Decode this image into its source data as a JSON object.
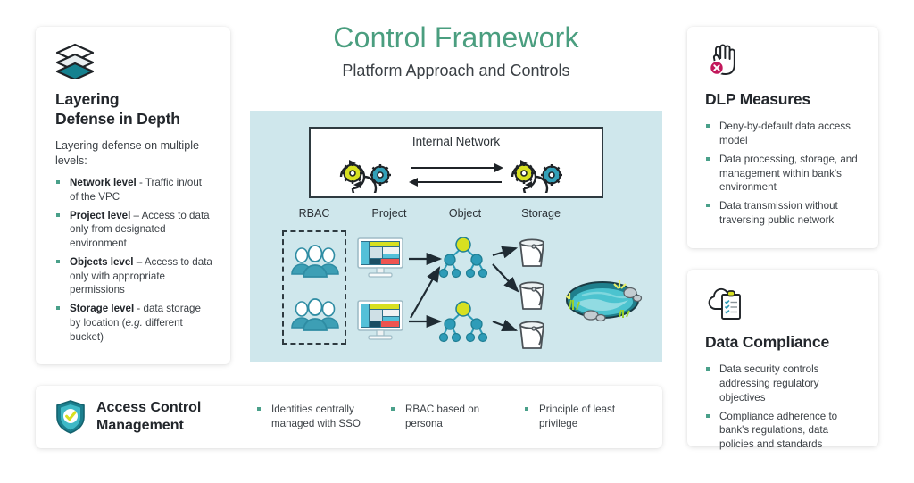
{
  "header": {
    "title": "Control Framework",
    "subtitle": "Platform Approach and Controls",
    "title_color": "#4a9e7f"
  },
  "layering_card": {
    "icon": "layers-icon",
    "title_line1": "Layering",
    "title_line2": "Defense in Depth",
    "intro": "Layering defense on multiple levels:",
    "bullets": [
      {
        "label": "Network level",
        "dash": " - ",
        "text": "Traffic in/out of the VPC"
      },
      {
        "label": "Project level",
        "dash": " – ",
        "text": "Access to data only from designated environment"
      },
      {
        "label": "Objects level",
        "dash": " – ",
        "text": "Access to data only with appropriate permissions"
      },
      {
        "label": "Storage level",
        "dash": " - ",
        "text": "data storage by location (",
        "italic": "e.g.",
        "text_after": " different bucket)"
      }
    ]
  },
  "diagram": {
    "panel_color": "#cfe7ec",
    "internal_network_label": "Internal Network",
    "column_labels": [
      "RBAC",
      "Project",
      "Object",
      "Storage"
    ],
    "gear_colors": {
      "yellow": "#d7e021",
      "teal": "#32a0b8"
    },
    "people_color": "#3d9fb5",
    "node_color": "#2e9cb8",
    "root_node_color": "#d7e021",
    "bucket_count": 3,
    "lake_label": "data-lake"
  },
  "dlp_card": {
    "icon": "stop-hand-icon",
    "title": "DLP Measures",
    "bullets": [
      "Deny-by-default data access model",
      "Data processing, storage, and management within bank's environment",
      "Data transmission without traversing public network"
    ]
  },
  "compliance_card": {
    "icon": "cloud-checklist-icon",
    "title": "Data Compliance",
    "bullets": [
      "Data security controls addressing regulatory objectives",
      "Compliance adherence to bank's regulations, data policies and standards"
    ]
  },
  "access_control_bar": {
    "icon": "shield-check-icon",
    "title_line1": "Access Control",
    "title_line2": "Management",
    "items": [
      "Identities centrally managed with SSO",
      "RBAC based on persona",
      "Principle of least privilege"
    ]
  },
  "colors": {
    "accent_teal": "#4aa08a",
    "panel": "#cfe7ec",
    "text_dark": "#22262b",
    "text_body": "#3c4146"
  }
}
